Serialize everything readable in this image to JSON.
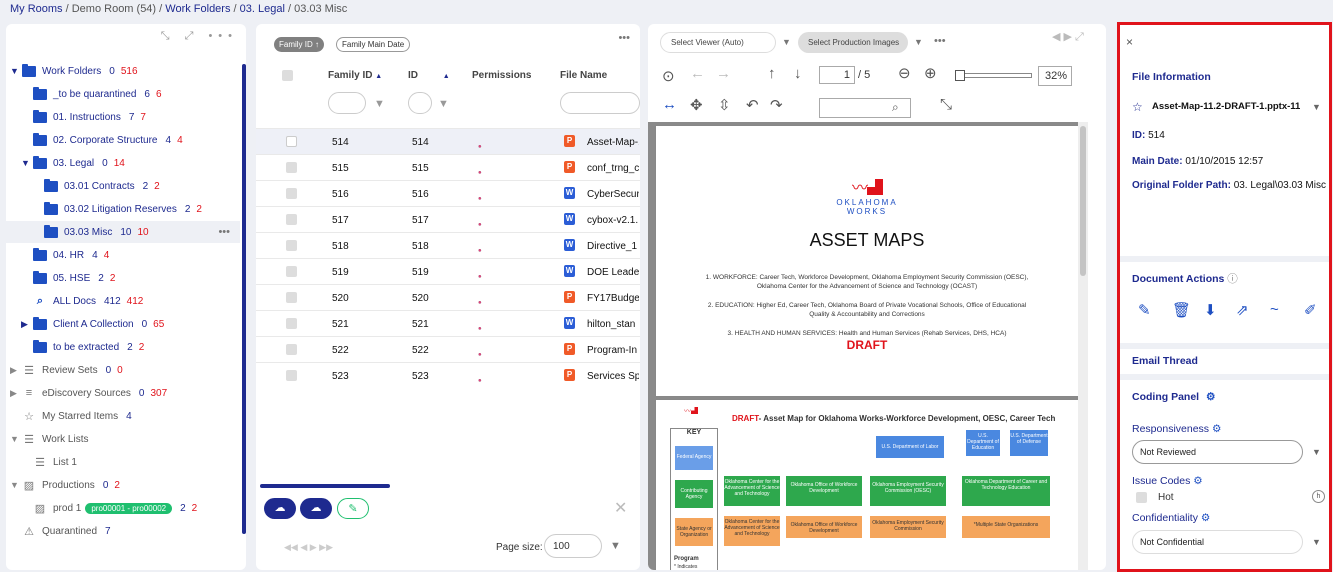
{
  "breadcrumb": [
    "My Rooms",
    "Demo Room (54)",
    "Work Folders",
    "03. Legal",
    "03.03 Misc"
  ],
  "tree": [
    {
      "label": "Work Folders",
      "c1": "0",
      "c2": "516",
      "toggle": "▼",
      "icon": "folder"
    },
    {
      "label": "_to be quarantined",
      "c1": "6",
      "c2": "6",
      "icon": "folder"
    },
    {
      "label": "01. Instructions",
      "c1": "7",
      "c2": "7",
      "icon": "folder"
    },
    {
      "label": "02. Corporate Structure",
      "c1": "4",
      "c2": "4",
      "icon": "folder"
    },
    {
      "label": "03. Legal",
      "c1": "0",
      "c2": "14",
      "toggle": "▼",
      "icon": "folder"
    },
    {
      "label": "03.01 Contracts",
      "c1": "2",
      "c2": "2",
      "icon": "folder"
    },
    {
      "label": "03.02 Litigation Reserves",
      "c1": "2",
      "c2": "2",
      "icon": "folder"
    },
    {
      "label": "03.03 Misc",
      "c1": "10",
      "c2": "10",
      "icon": "folder",
      "more": "•••"
    },
    {
      "label": "04. HR",
      "c1": "4",
      "c2": "4",
      "icon": "folder"
    },
    {
      "label": "05. HSE",
      "c1": "2",
      "c2": "2",
      "icon": "folder"
    },
    {
      "label": "ALL Docs",
      "c1": "412",
      "c2": "412",
      "icon": "search"
    },
    {
      "label": "Client A Collection",
      "c1": "0",
      "c2": "65",
      "toggle": "▶",
      "icon": "folder"
    },
    {
      "label": "to be extracted",
      "c1": "2",
      "c2": "2",
      "icon": "folder"
    },
    {
      "label": "Review Sets",
      "c1": "0",
      "c2": "0",
      "toggle": "▶",
      "icon": "list"
    },
    {
      "label": "eDiscovery Sources",
      "c1": "0",
      "c2": "307",
      "toggle": "▶",
      "icon": "db"
    },
    {
      "label": "My Starred Items",
      "c1": "4",
      "icon": "star"
    },
    {
      "label": "Work Lists",
      "toggle": "▼",
      "icon": "list"
    },
    {
      "label": "List 1",
      "icon": "list"
    },
    {
      "label": "Productions",
      "c1": "0",
      "c2": "2",
      "toggle": "▼",
      "icon": "prod"
    },
    {
      "label": "prod 1",
      "c1": "2",
      "c2": "2",
      "icon": "prod",
      "badge": "pro00001 - pro00002"
    },
    {
      "label": "Quarantined",
      "c1": "7",
      "icon": "warn"
    }
  ],
  "grid": {
    "chips": [
      "Family ID ↑",
      "Family Main Date"
    ],
    "headers": [
      "Family ID",
      "ID",
      "Permissions",
      "File Name"
    ],
    "rows": [
      {
        "fid": "514",
        "id": "514",
        "type": "P",
        "name": "Asset-Map-1"
      },
      {
        "fid": "515",
        "id": "515",
        "type": "P",
        "name": "conf_trng_c"
      },
      {
        "fid": "516",
        "id": "516",
        "type": "W",
        "name": "CyberSecur"
      },
      {
        "fid": "517",
        "id": "517",
        "type": "W",
        "name": "cybox-v2.1."
      },
      {
        "fid": "518",
        "id": "518",
        "type": "W",
        "name": "Directive_1"
      },
      {
        "fid": "519",
        "id": "519",
        "type": "W",
        "name": "DOE Leade"
      },
      {
        "fid": "520",
        "id": "520",
        "type": "P",
        "name": "FY17Budge"
      },
      {
        "fid": "521",
        "id": "521",
        "type": "W",
        "name": "hilton_stan"
      },
      {
        "fid": "522",
        "id": "522",
        "type": "P",
        "name": "Program-In"
      },
      {
        "fid": "523",
        "id": "523",
        "type": "P",
        "name": "Services Sp"
      }
    ],
    "page_size_label": "Page size:",
    "page_size": "100"
  },
  "viewer": {
    "viewer_select": "Select Viewer (Auto)",
    "prod_select": "Select Production Images",
    "page": "1",
    "pages": "/ 5",
    "zoom": "32%",
    "doc_logo": "OKLAHOMA",
    "doc_logo2": "WORKS",
    "doc_title": "ASSET MAPS",
    "lines": [
      "1. WORKFORCE: Career Tech, Workforce Development, Oklahoma Employment Security Commission (OESC), Oklahoma Center for the Advancement of Science and Technology (OCAST)",
      "2. EDUCATION: Higher Ed, Career Tech, Oklahoma Board of Private Vocational Schools, Office of Educational Quality & Accountability and Corrections",
      "3. HEALTH AND HUMAN SERVICES: Health and Human Services (Rehab Services, DHS, HCA)"
    ],
    "draft": "DRAFT",
    "page2_title_red": "DRAFT",
    "page2_title": "- Asset Map for Oklahoma Works-Workforce Development, OESC, Career Tech",
    "key": "KEY",
    "key_items": [
      "Federal Agency",
      "Contributing Agency",
      "State Agency or Organization"
    ],
    "boxes_blue": [
      "U.S. Department of Labor",
      "U.S. Department of Education",
      "U.S. Department of Defense"
    ],
    "boxes_green": [
      "Oklahoma Center for the Advancement of Science and Technology",
      "Oklahoma Office of Workforce Development",
      "Oklahoma Employment Security Commission (OESC)",
      "Oklahoma Department of Career and Technology Education"
    ],
    "boxes_orange": [
      "Oklahoma Center for the Advancement of Science and Technology",
      "Oklahoma Office of Workforce Development",
      "Oklahoma Employment Security Commission",
      "*Multiple State Organizations"
    ],
    "program": "Program",
    "indicates": "* Indicates"
  },
  "info": {
    "file_info": "File Information",
    "file_name": "Asset-Map-11.2-DRAFT-1.pptx-11",
    "id_label": "ID:",
    "id": "514",
    "date_label": "Main Date:",
    "date": "01/10/2015 12:57",
    "path_label": "Original Folder Path:",
    "path": "03. Legal\\03.03 Misc",
    "doc_actions": "Document Actions",
    "email_thread": "Email Thread",
    "coding_panel": "Coding Panel",
    "responsiveness": "Responsiveness",
    "resp_value": "Not Reviewed",
    "issue_codes": "Issue Codes",
    "hot": "Hot",
    "hot_key": "h",
    "confidentiality": "Confidentiality",
    "conf_value": "Not Confidential"
  }
}
